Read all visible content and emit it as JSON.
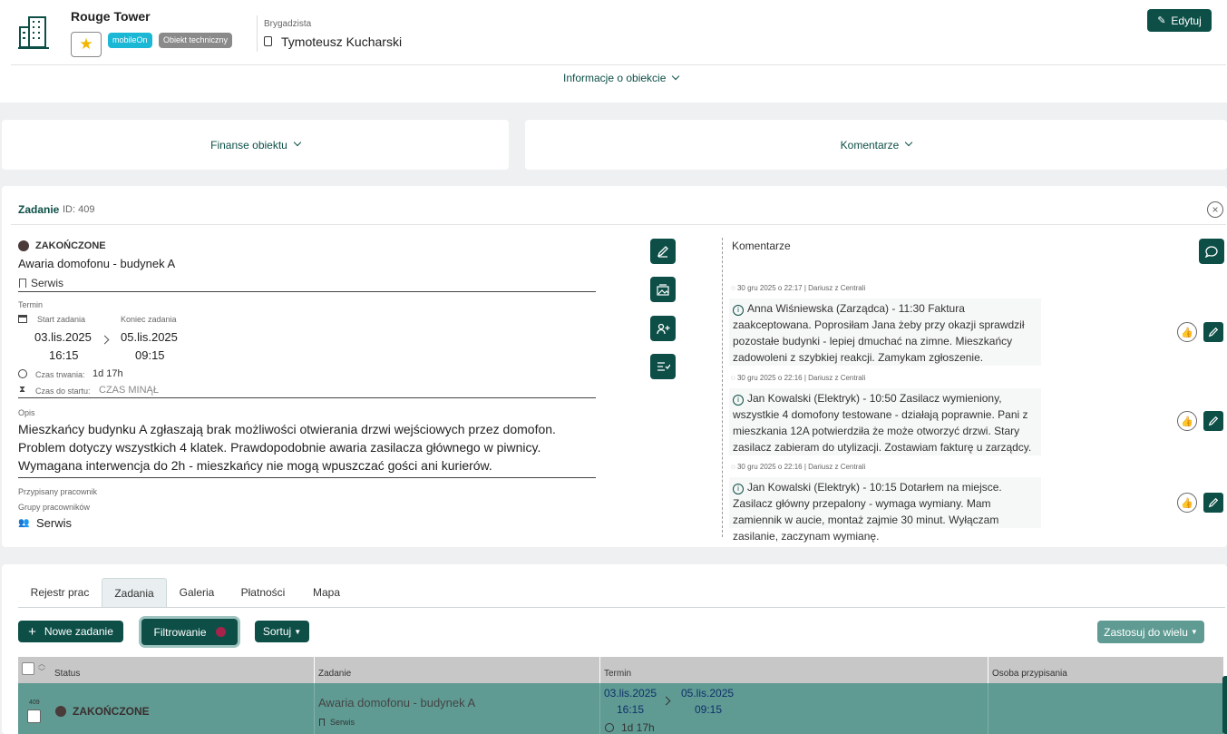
{
  "header": {
    "title": "Rouge Tower",
    "badges": [
      "mobileOn",
      "Obiekt techniczny"
    ],
    "foreman_label": "Brygadzista",
    "foreman_name": "Tymoteusz Kucharski",
    "edit_label": "Edytuj",
    "info_toggle": "Informacje o obiekcie"
  },
  "sections": {
    "finance": "Finanse obiektu",
    "comments": "Komentarze"
  },
  "task": {
    "label": "Zadanie",
    "id": "ID: 409",
    "status": "ZAKOŃCZONE",
    "title": "Awaria domofonu - budynek A",
    "category": "Serwis",
    "term_label": "Termin",
    "start_label": "Start zadania",
    "end_label": "Koniec zadania",
    "start_date": "03.lis.2025",
    "start_time": "16:15",
    "end_date": "05.lis.2025",
    "end_time": "09:15",
    "duration_label": "Czas trwania:",
    "duration_value": "1d 17h",
    "to_start_label": "Czas do startu:",
    "to_start_value": "CZAS MINĄŁ",
    "desc_label": "Opis",
    "description": "Mieszkańcy budynku A zgłaszają brak możliwości otwierania drzwi wejściowych przez domofon. Problem dotyczy wszystkich 4 klatek. Prawdopodobnie awaria zasilacza głównego w piwnicy. Wymagana interwencja do 2h - mieszkańcy nie mogą wpuszczać gości ani kurierów.",
    "assigned_label": "Przypisany pracownik",
    "groups_label": "Grupy pracowników",
    "group_value": "Serwis"
  },
  "comments": {
    "title": "Komentarze",
    "items": [
      {
        "meta": "30 gru 2025 o 22:17 | Dariusz z Centrali",
        "text": "Anna Wiśniewska (Zarządca) - 11:30 Faktura zaakceptowana. Poprosiłam Jana żeby przy okazji sprawdził pozostałe budynki - lepiej dmuchać na zimne. Mieszkańcy zadowoleni z szybkiej reakcji. Zamykam zgłoszenie."
      },
      {
        "meta": "30 gru 2025 o 22:16 | Dariusz z Centrali",
        "text": "Jan Kowalski (Elektryk) - 10:50 Zasilacz wymieniony, wszystkie 4 domofony testowane - działają poprawnie. Pani z mieszkania 12A potwierdziła że może otworzyć drzwi. Stary zasilacz zabieram do utylizacji. Zostawiam fakturę u zarządcy."
      },
      {
        "meta": "30 gru 2025 o 22:16 | Dariusz z Centrali",
        "text": "Jan Kowalski (Elektryk) - 10:15 Dotarłem na miejsce. Zasilacz główny przepalony - wymaga wymiany. Mam zamiennik w aucie, montaż zajmie 30 minut. Wyłączam zasilanie, zaczynam wymianę."
      }
    ]
  },
  "tabs": [
    "Rejestr prac",
    "Zadania",
    "Galeria",
    "Płatności",
    "Mapa"
  ],
  "toolbar": {
    "new_task": "Nowe zadanie",
    "filter": "Filtrowanie",
    "sort": "Sortuj",
    "apply_many": "Zastosuj do wielu"
  },
  "table": {
    "headers": [
      "Status",
      "Zadanie",
      "Termin",
      "Osoba przypisania"
    ],
    "row": {
      "id": "409",
      "status": "ZAKOŃCZONE",
      "title": "Awaria domofonu - budynek A",
      "category": "Serwis",
      "start_date": "03.lis.2025",
      "start_time": "16:15",
      "end_date": "05.lis.2025",
      "end_time": "09:15",
      "duration": "1d 17h"
    }
  },
  "colors": {
    "accent": "#0d4f47",
    "row_bg": "#5f9b93",
    "badge_cyan": "#1bb8d6",
    "badge_grey": "#8a8a8a"
  }
}
